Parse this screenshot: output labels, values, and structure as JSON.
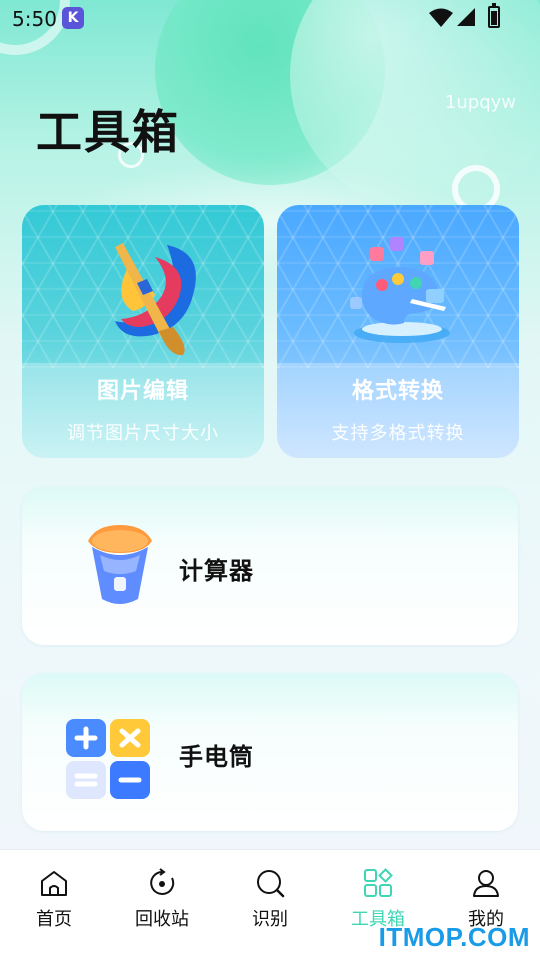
{
  "status_bar": {
    "time": "5:50",
    "app_icon_letter": "K"
  },
  "header": {
    "title": "工具箱",
    "watermark": "1upqyw"
  },
  "feature_cards": [
    {
      "title": "图片编辑",
      "subtitle": "调节图片尺寸大小"
    },
    {
      "title": "格式转换",
      "subtitle": "支持多格式转换"
    }
  ],
  "list_cards": [
    {
      "title": "计算器",
      "icon": "flashlight-icon"
    },
    {
      "title": "手电筒",
      "icon": "calculator-icon"
    }
  ],
  "bottom_nav": {
    "items": [
      {
        "label": "首页",
        "icon": "home-icon"
      },
      {
        "label": "回收站",
        "icon": "recycle-icon"
      },
      {
        "label": "识别",
        "icon": "search-icon"
      },
      {
        "label": "工具箱",
        "icon": "toolbox-icon"
      },
      {
        "label": "我的",
        "icon": "profile-icon"
      }
    ],
    "active_index": 3
  },
  "site_watermark": "ITMOP.COM",
  "colors": {
    "accent": "#3fd6b5",
    "edit_card": "#33c9d6",
    "format_card": "#4aa8ff",
    "watermark": "#1a9be8"
  }
}
